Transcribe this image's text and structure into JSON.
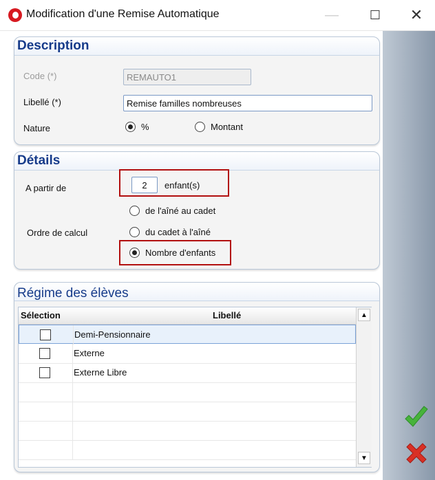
{
  "window": {
    "title": "Modification d'une Remise Automatique",
    "minimize_glyph": "—",
    "maximize_glyph": "☐",
    "close_glyph": "✕"
  },
  "description": {
    "title": "Description",
    "code_label": "Code (*)",
    "code_value": "REMAUTO1",
    "libelle_label": "Libellé (*)",
    "libelle_value": "Remise familles nombreuses",
    "nature_label": "Nature",
    "nature_option_percent": "%",
    "nature_option_montant": "Montant",
    "nature_selected": "%"
  },
  "details": {
    "title": "Détails",
    "apartir_label": "A partir de",
    "enfants_value": "2",
    "enfants_unit": "enfant(s)",
    "ordre_label": "Ordre de calcul",
    "options": [
      {
        "label": "de l'aîné au cadet"
      },
      {
        "label": "du cadet à l'aîné"
      },
      {
        "label": "Nombre d'enfants"
      }
    ],
    "selected_option": "Nombre d'enfants"
  },
  "regime": {
    "title": "Régime des élèves",
    "columns": {
      "selection": "Sélection",
      "libelle": "Libellé"
    },
    "rows": [
      {
        "label": "Demi-Pensionnaire"
      },
      {
        "label": "Externe"
      },
      {
        "label": "Externe Libre"
      }
    ],
    "scroll_up_glyph": "▲",
    "scroll_down_glyph": "▼"
  },
  "actions": {
    "validate_icon": "green-checkmark-icon",
    "cancel_icon": "red-x-icon"
  },
  "colors": {
    "section_title": "#163b8a",
    "highlight_border": "#b20f0f",
    "validate": "#47b33b",
    "cancel": "#d93025"
  }
}
